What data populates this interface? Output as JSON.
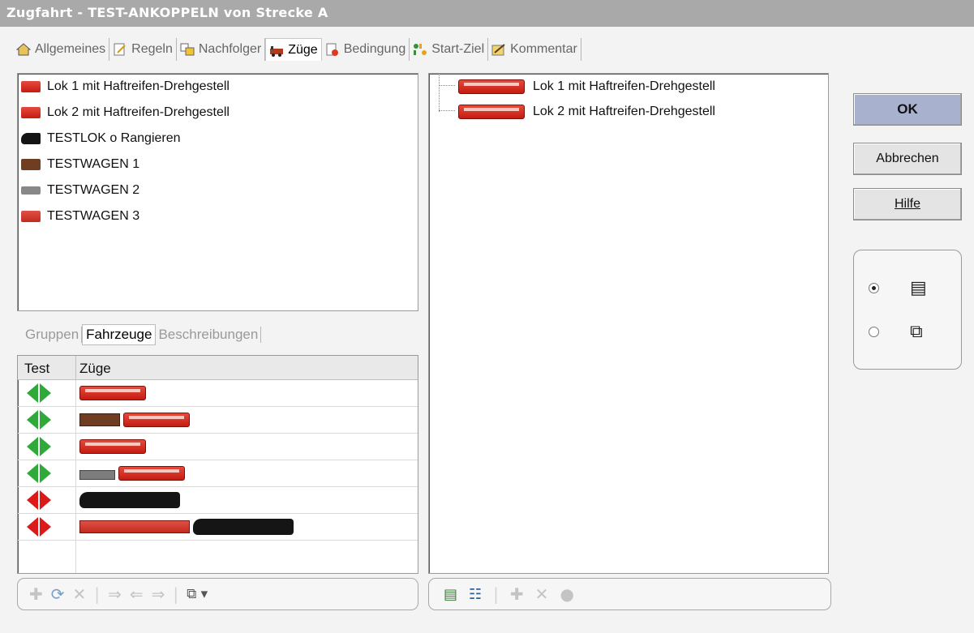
{
  "window": {
    "title": "Zugfahrt - TEST-ANKOPPELN von Strecke A"
  },
  "tabs": [
    {
      "label": "Allgemeines",
      "icon": "house-settings-icon",
      "active": false
    },
    {
      "label": "Regeln",
      "icon": "rules-icon",
      "active": false
    },
    {
      "label": "Nachfolger",
      "icon": "successor-icon",
      "active": false
    },
    {
      "label": "Züge",
      "icon": "trains-icon",
      "active": true
    },
    {
      "label": "Bedingung",
      "icon": "condition-icon",
      "active": false
    },
    {
      "label": "Start-Ziel",
      "icon": "start-goal-icon",
      "active": false
    },
    {
      "label": "Kommentar",
      "icon": "comment-icon",
      "active": false
    }
  ],
  "vehicles": [
    {
      "label": "Lok 1 mit Haftreifen-Drehgestell",
      "icon": "red-locomotive-icon"
    },
    {
      "label": "Lok 2 mit Haftreifen-Drehgestell",
      "icon": "red-locomotive-icon"
    },
    {
      "label": "TESTLOK o Rangieren",
      "icon": "steam-locomotive-icon"
    },
    {
      "label": "TESTWAGEN 1",
      "icon": "brown-wagon-icon"
    },
    {
      "label": "TESTWAGEN 2",
      "icon": "grey-wagon-icon"
    },
    {
      "label": "TESTWAGEN 3",
      "icon": "red-coach-icon"
    }
  ],
  "subtabs": [
    {
      "label": "Gruppen",
      "active": false
    },
    {
      "label": "Fahrzeuge",
      "active": true
    },
    {
      "label": "Beschreibungen",
      "active": false
    }
  ],
  "grid": {
    "columns": [
      "Test",
      "Züge"
    ],
    "rows": [
      {
        "status": "green",
        "status_color": "#2faa3a",
        "trains": [
          "red-locomotive"
        ]
      },
      {
        "status": "green",
        "status_color": "#2faa3a",
        "trains": [
          "brown-wagon",
          "red-locomotive"
        ]
      },
      {
        "status": "green",
        "status_color": "#2faa3a",
        "trains": [
          "red-locomotive"
        ]
      },
      {
        "status": "green",
        "status_color": "#2faa3a",
        "trains": [
          "grey-wagon",
          "red-locomotive"
        ]
      },
      {
        "status": "red",
        "status_color": "#dd1a1a",
        "trains": [
          "steam-locomotive"
        ]
      },
      {
        "status": "red",
        "status_color": "#dd1a1a",
        "trains": [
          "red-coach",
          "steam-locomotive"
        ]
      }
    ]
  },
  "tree": [
    {
      "label": "Lok 1 mit Haftreifen-Drehgestell",
      "icon": "red-locomotive-icon"
    },
    {
      "label": "Lok 2 mit Haftreifen-Drehgestell",
      "icon": "red-locomotive-icon"
    }
  ],
  "buttons": {
    "ok": "OK",
    "cancel": "Abbrechen",
    "help": "Hilfe"
  },
  "view_mode": {
    "selected": "list"
  },
  "toolbar_left": [
    "add-icon",
    "refresh-icon",
    "delete-icon",
    "arrow-right-icon",
    "arrow-left-icon",
    "arrow-right-icon",
    "copy-dropdown-icon"
  ],
  "toolbar_right": [
    "new-item-icon",
    "tree-icon",
    "add-icon",
    "delete-icon",
    "stop-icon"
  ]
}
